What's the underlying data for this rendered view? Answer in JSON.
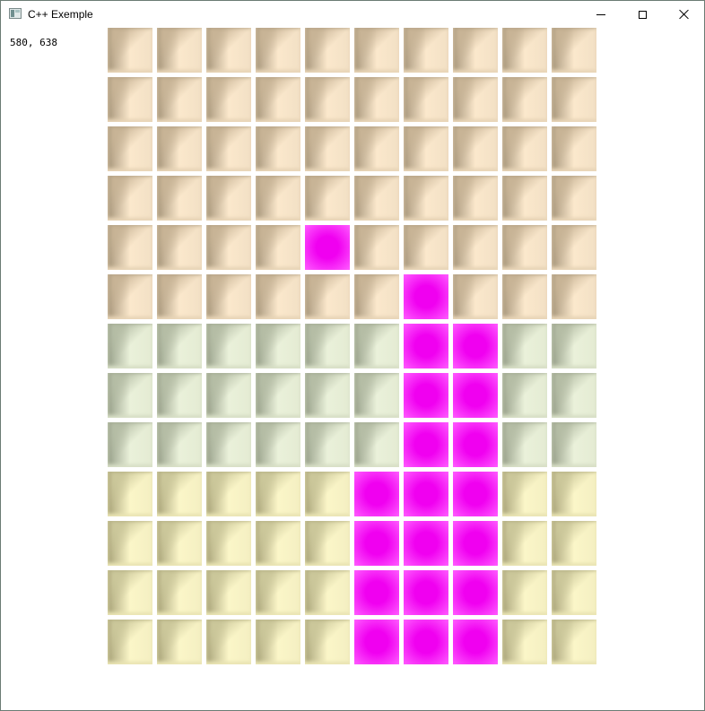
{
  "window": {
    "title": "C++ Exemple",
    "controls": {
      "minimize_icon": "minimize-icon",
      "maximize_icon": "maximize-icon",
      "close_icon": "close-icon"
    }
  },
  "cursor_readout": "580, 638",
  "board": {
    "columns": 10,
    "rows": 13,
    "row_themes": [
      "tan",
      "tan",
      "tan",
      "tan",
      "tan",
      "tan",
      "sage",
      "sage",
      "sage",
      "khaki",
      "khaki",
      "khaki",
      "khaki"
    ],
    "highlighted_cells": [
      [
        4,
        4
      ],
      [
        5,
        6
      ],
      [
        6,
        6
      ],
      [
        6,
        7
      ],
      [
        7,
        6
      ],
      [
        7,
        7
      ],
      [
        8,
        6
      ],
      [
        8,
        7
      ],
      [
        9,
        5
      ],
      [
        9,
        6
      ],
      [
        9,
        7
      ],
      [
        10,
        5
      ],
      [
        10,
        6
      ],
      [
        10,
        7
      ],
      [
        11,
        5
      ],
      [
        11,
        6
      ],
      [
        11,
        7
      ],
      [
        12,
        5
      ],
      [
        12,
        6
      ],
      [
        12,
        7
      ]
    ],
    "colors": {
      "tan": {
        "top": "#c8b496",
        "left": "#a8977c",
        "right": "#f2e0c5",
        "bottom": "#ecd9bb",
        "center": "#fbe8cc"
      },
      "sage": {
        "top": "#b5bda5",
        "left": "#98a08a",
        "right": "#e4ebd3",
        "bottom": "#dce3ca",
        "center": "#eaf1da"
      },
      "khaki": {
        "top": "#cbc79a",
        "left": "#a9a47a",
        "right": "#f4efc2",
        "bottom": "#eee9b8",
        "center": "#fbf6c8"
      },
      "highlight": {
        "edge": "#ff5cff",
        "center": "#f000f0"
      }
    }
  }
}
